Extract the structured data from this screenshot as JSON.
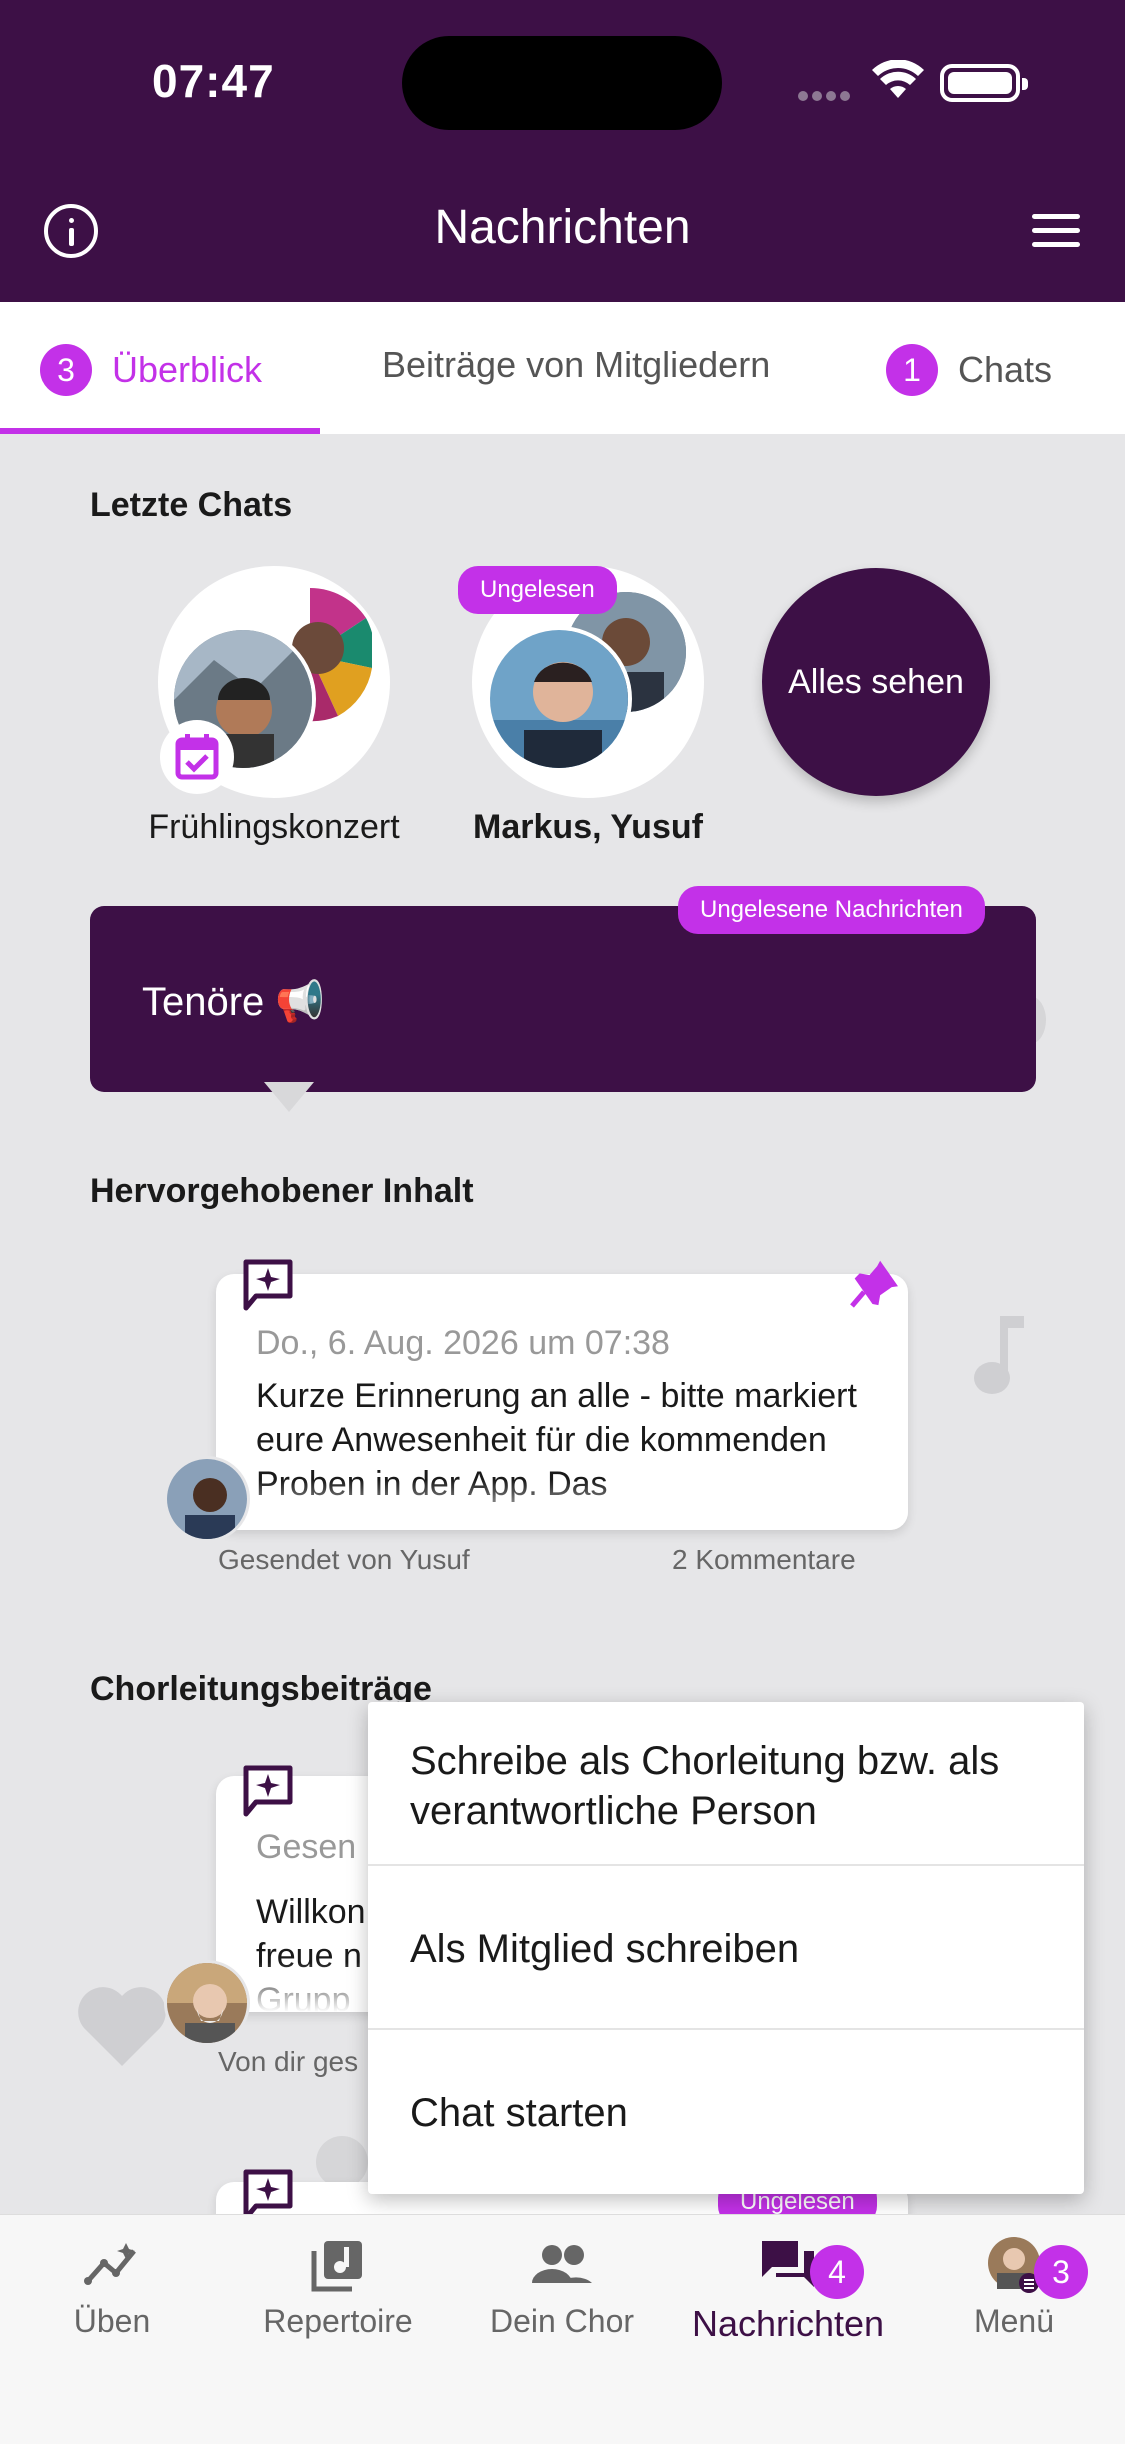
{
  "status_bar": {
    "time": "07:47"
  },
  "header": {
    "title": "Nachrichten"
  },
  "tabs": [
    {
      "label": "Überblick",
      "count": "3",
      "active": true
    },
    {
      "label": "Beiträge von Mitgliedern",
      "active": false
    },
    {
      "label": "Chats",
      "count": "1",
      "active": false
    }
  ],
  "recent_chats": {
    "title": "Letzte Chats",
    "items": [
      {
        "name": "Frühlingskonzert"
      },
      {
        "name": "Markus, Yusuf",
        "badge": "Ungelesen"
      }
    ],
    "see_all_label": "Alles sehen"
  },
  "group_card": {
    "label": "Tenöre 📢",
    "badge": "Ungelesene Nachrichten"
  },
  "highlighted": {
    "title": "Hervorgehobener Inhalt",
    "post": {
      "date": "Do., 6. Aug. 2026 um 07:38",
      "text": "Kurze Erinnerung an alle - bitte markiert eure Anwesenheit für die kommenden Proben in der App. Das",
      "sender": "Gesendet von Yusuf",
      "comments": "2 Kommentare"
    }
  },
  "conductor_posts": {
    "title": "Chorleitungsbeiträge",
    "post": {
      "date": "Gesen",
      "text": "Willkon freue n Grupp",
      "sender": "Von dir ges"
    },
    "next_badge": "Ungelesen"
  },
  "popup_menu": {
    "items": [
      "Schreibe als Chorleitung bzw. als verantwortliche Person",
      "Als Mitglied schreiben",
      "Chat starten"
    ]
  },
  "bottom_nav": {
    "items": [
      {
        "label": "Üben",
        "icon": "practice-icon"
      },
      {
        "label": "Repertoire",
        "icon": "music-library-icon"
      },
      {
        "label": "Dein Chor",
        "icon": "group-icon"
      },
      {
        "label": "Nachrichten",
        "icon": "chat-icon",
        "badge": "4",
        "active": true
      },
      {
        "label": "Menü",
        "icon": "profile-menu-icon",
        "badge": "3"
      }
    ]
  },
  "colors": {
    "primary": "#3d1046",
    "accent": "#c331e8",
    "background": "#e6e6e8"
  }
}
